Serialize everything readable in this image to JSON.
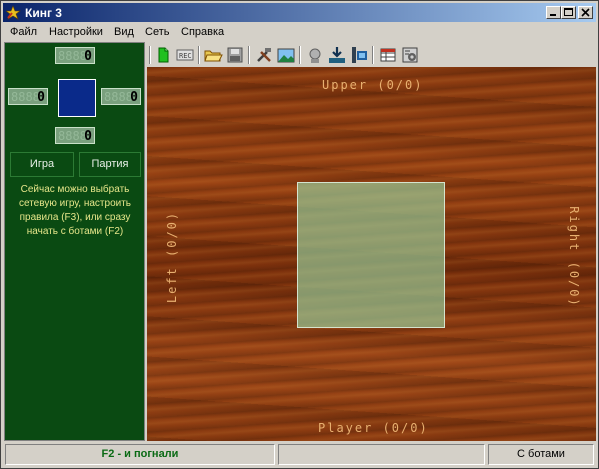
{
  "window": {
    "title": "Кинг 3"
  },
  "menu": {
    "items": [
      "Файл",
      "Настройки",
      "Вид",
      "Сеть",
      "Справка"
    ]
  },
  "scores": {
    "ghost": "8888",
    "top": "0",
    "left": "0",
    "right": "0",
    "bottom": "0"
  },
  "panel": {
    "tab_game": "Игра",
    "tab_match": "Партия",
    "message": "Сейчас можно выбрать сетевую игру, настроить правила (F3), или сразу начать с ботами (F2)"
  },
  "toolbar": {
    "icons": [
      "new-game-icon",
      "record-icon",
      "open-icon",
      "save-icon",
      "tools-icon",
      "picture-icon",
      "bot-icon",
      "download-icon",
      "network-icon",
      "table-icon",
      "settings-icon"
    ]
  },
  "table": {
    "upper": "Upper (0/0)",
    "left": "Left (0/0)",
    "right": "Right (0/0)",
    "player": "Player (0/0)"
  },
  "statusbar": {
    "hint": "F2 - и погнали",
    "middle": "",
    "mode": "С ботами"
  },
  "colors": {
    "panel_bg": "#0a4a12",
    "suit_box": "#0a2a8a",
    "hint_text": "#0a6a14",
    "message_text": "#e6e68a",
    "seat_text": "#e8b070"
  }
}
